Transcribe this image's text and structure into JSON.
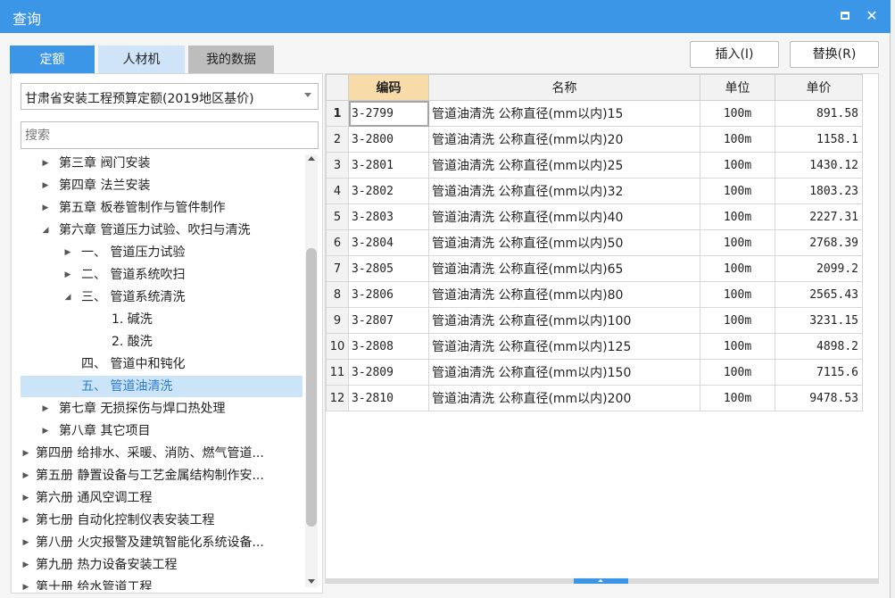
{
  "window": {
    "title": "查询"
  },
  "tabs": [
    {
      "label": "定额"
    },
    {
      "label": "人材机"
    },
    {
      "label": "我的数据"
    }
  ],
  "actions": {
    "insert_label": "插入(I)",
    "replace_label": "替换(R)"
  },
  "library": {
    "selected": "甘肃省安装工程预算定额(2019地区基价)"
  },
  "search": {
    "placeholder": "搜索"
  },
  "tree": [
    {
      "label": "第三章 阀门安装",
      "toggle": "▶"
    },
    {
      "label": "第四章 法兰安装",
      "toggle": "▶"
    },
    {
      "label": "第五章 板卷管制作与管件制作",
      "toggle": "▶"
    },
    {
      "label": "第六章 管道压力试验、吹扫与清洗",
      "toggle": "◢"
    },
    {
      "label": "一、 管道压力试验",
      "toggle": "▶"
    },
    {
      "label": "二、 管道系统吹扫",
      "toggle": "▶"
    },
    {
      "label": "三、 管道系统清洗",
      "toggle": "◢"
    },
    {
      "label": "1. 碱洗",
      "toggle": ""
    },
    {
      "label": "2. 酸洗",
      "toggle": ""
    },
    {
      "label": "四、 管道中和钝化",
      "toggle": ""
    },
    {
      "label": "五、 管道油清洗",
      "toggle": ""
    },
    {
      "label": "第七章 无损探伤与焊口热处理",
      "toggle": "▶"
    },
    {
      "label": "第八章 其它项目",
      "toggle": "▶"
    },
    {
      "label": "第四册 给排水、采暖、消防、燃气管道...",
      "toggle": "▶"
    },
    {
      "label": "第五册 静置设备与工艺金属结构制作安...",
      "toggle": "▶"
    },
    {
      "label": "第六册 通风空调工程",
      "toggle": "▶"
    },
    {
      "label": "第七册 自动化控制仪表安装工程",
      "toggle": "▶"
    },
    {
      "label": "第八册 火灾报警及建筑智能化系统设备...",
      "toggle": "▶"
    },
    {
      "label": "第九册 热力设备安装工程",
      "toggle": "▶"
    },
    {
      "label": "第十册 给水管道工程",
      "toggle": "▶"
    }
  ],
  "table": {
    "headers": [
      "编码",
      "名称",
      "单位",
      "单价"
    ],
    "rows": [
      {
        "no": "1",
        "code": "3-2799",
        "name": "管道油清洗 公称直径(mm以内)15",
        "unit": "100m",
        "price": "891.58"
      },
      {
        "no": "2",
        "code": "3-2800",
        "name": "管道油清洗 公称直径(mm以内)20",
        "unit": "100m",
        "price": "1158.1"
      },
      {
        "no": "3",
        "code": "3-2801",
        "name": "管道油清洗 公称直径(mm以内)25",
        "unit": "100m",
        "price": "1430.12"
      },
      {
        "no": "4",
        "code": "3-2802",
        "name": "管道油清洗 公称直径(mm以内)32",
        "unit": "100m",
        "price": "1803.23"
      },
      {
        "no": "5",
        "code": "3-2803",
        "name": "管道油清洗 公称直径(mm以内)40",
        "unit": "100m",
        "price": "2227.31"
      },
      {
        "no": "6",
        "code": "3-2804",
        "name": "管道油清洗 公称直径(mm以内)50",
        "unit": "100m",
        "price": "2768.39"
      },
      {
        "no": "7",
        "code": "3-2805",
        "name": "管道油清洗 公称直径(mm以内)65",
        "unit": "100m",
        "price": "2099.2"
      },
      {
        "no": "8",
        "code": "3-2806",
        "name": "管道油清洗 公称直径(mm以内)80",
        "unit": "100m",
        "price": "2565.43"
      },
      {
        "no": "9",
        "code": "3-2807",
        "name": "管道油清洗 公称直径(mm以内)100",
        "unit": "100m",
        "price": "3231.15"
      },
      {
        "no": "10",
        "code": "3-2808",
        "name": "管道油清洗 公称直径(mm以内)125",
        "unit": "100m",
        "price": "4898.2"
      },
      {
        "no": "11",
        "code": "3-2809",
        "name": "管道油清洗 公称直径(mm以内)150",
        "unit": "100m",
        "price": "7115.6"
      },
      {
        "no": "12",
        "code": "3-2810",
        "name": "管道油清洗 公称直径(mm以内)200",
        "unit": "100m",
        "price": "9478.53"
      }
    ]
  },
  "colors": {
    "accent": "#3c96e7",
    "selection": "#cce4f7",
    "header_highlight": "#f7dcaa"
  }
}
